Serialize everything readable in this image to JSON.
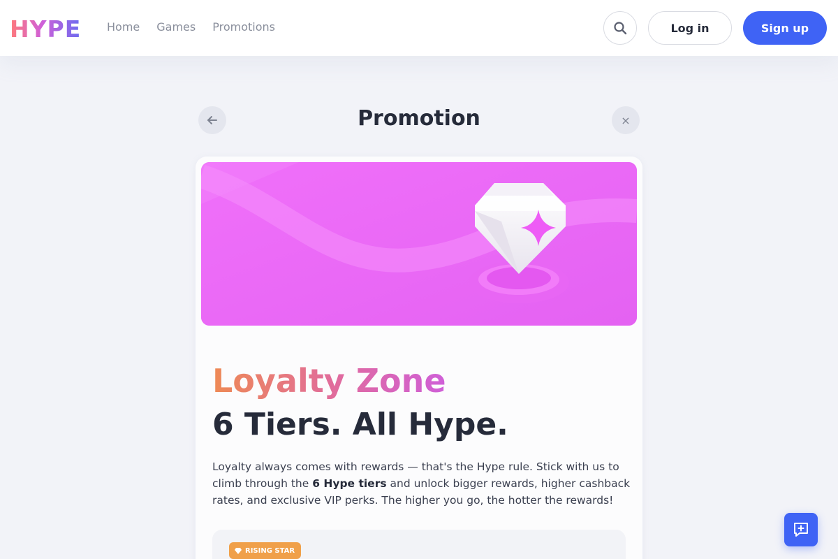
{
  "header": {
    "logo": "HYPE",
    "nav": [
      "Home",
      "Games",
      "Promotions"
    ],
    "search_icon": "search-icon",
    "login_label": "Log in",
    "signup_label": "Sign up",
    "colors": {
      "primary": "#3f63f5"
    }
  },
  "page": {
    "title": "Promotion",
    "back_icon": "arrow-left-icon",
    "close_icon": "close-icon",
    "close_glyph": "×"
  },
  "promo": {
    "banner_icon": "diamond-sparkle-icon",
    "banner_color": "#ea6af6",
    "name": "Loyalty Zone",
    "headline": "6 Tiers. All Hype.",
    "description": {
      "before": "Loyalty always comes with rewards — that's the Hype rule. Stick with us to climb through the ",
      "bold": "6 Hype tiers",
      "after": " and unlock bigger rewards, higher cashback rates, and exclusive VIP perks. The higher you go, the hotter the rewards!"
    },
    "tier_badge": "RISING STAR",
    "tier_badge_color": "#f0a04a"
  },
  "chat": {
    "icon": "chat-plus-icon"
  }
}
